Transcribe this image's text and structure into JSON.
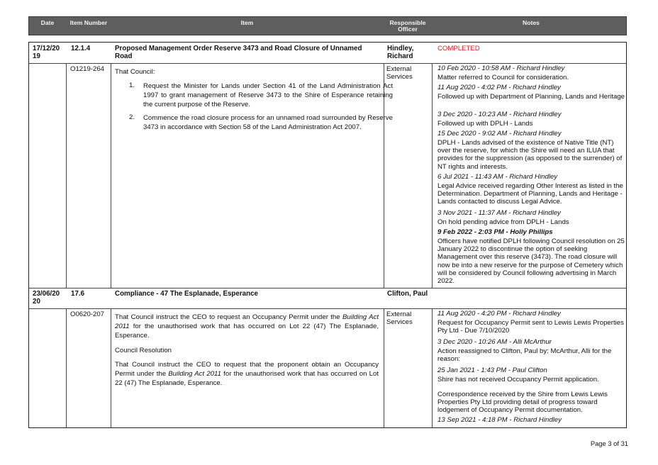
{
  "header": {
    "date": "Date",
    "item_number": "Item Number",
    "item": "Item",
    "responsible_officer": "Responsible Officer",
    "notes": "Notes"
  },
  "rows": [
    {
      "date": "17/12/20 19",
      "item_no": "12.1.4",
      "title": "Proposed Management Order Reserve 3473 and Road Closure of Unnamed Road",
      "officer": "Hindley, Richard",
      "status": "COMPLETED",
      "resolution_no": "O1219-264",
      "department": "External Services",
      "body_intro": "That Council:",
      "body_list": [
        {
          "n": "1.",
          "text": "Request the Minister for Lands under Section 41 of the Land Administration Act 1997 to grant management of Reserve 3473 to the Shire of Esperance retaining the current purpose of the Reserve."
        },
        {
          "n": "2.",
          "text": "Commence the road closure process for an unnamed road surrounded by Reserve 3473 in accordance with Section 58 of the Land Administration Act 2007."
        }
      ],
      "notes": [
        {
          "stamp": "10 Feb 2020 - 10:58 AM - Richard Hindley",
          "text": "Matter referred to Council for consideration."
        },
        {
          "stamp": "11 Aug 2020 - 4:02 PM - Richard Hindley",
          "text": "Followed up with Department of Planning, Lands and Heritage"
        },
        {
          "stamp": "3 Dec 2020 - 10:23 AM - Richard Hindley",
          "text": "Followed up with DPLH - Lands"
        },
        {
          "stamp": "15 Dec 2020 - 9:02 AM - Richard Hindley",
          "text": "DPLH - Lands advised of the existence of Native Title (NT) over the reserve, for which the Shire will need an ILUA that provides for the suppression (as opposed to the surrender) of NT rights and interests."
        },
        {
          "stamp": "6 Jul 2021 - 11:43 AM - Richard Hindley",
          "text": "Legal Advice received regarding Other Interest as listed in the Determination. Department of Planning, Lands and Heritage - Lands contacted to discuss Legal Advice."
        },
        {
          "stamp": "3 Nov 2021 - 11:37 AM - Richard Hindley",
          "text": "On hold pending advice from DPLH - Lands"
        },
        {
          "stamp": "9 Feb 2022 - 2:03 PM - Holly Phillips",
          "text": "Officers have notified DPLH following Council resolution on 25 January 2022 to discontinue the option of seeking Management over this reserve (3473). The road closure will now be into a new reserve for the purpose of Cemetery which will be considered by Council following advertising in March 2022."
        }
      ]
    },
    {
      "date": "23/06/20 20",
      "item_no": "17.6",
      "title": "Compliance - 47 The Esplanade, Esperance",
      "officer": "Clifton, Paul",
      "resolution_no": "O0620-207",
      "department": "External Services",
      "body_p1_a": "That Council instruct the CEO to request an Occupancy Permit under the ",
      "body_p1_act": "Building Act 2011",
      "body_p1_b": " for the unauthorised work that has occurred on Lot 22 (47) The Esplanade, Esperance.",
      "council_resolution": "Council Resolution",
      "body_p2_a": "That Council instruct the CEO to request that the proponent obtain an Occupancy Permit under the ",
      "body_p2_act": "Building Act 2011",
      "body_p2_b": " for the unauthorised work that has occurred on Lot 22 (47) The Esplanade, Esperance.",
      "notes": [
        {
          "stamp": "11 Aug 2020 - 4:20 PM - Richard Hindley",
          "text": "Request for Occupancy Permit sent to Lewis Lewis Properties Pty Ltd - Due 7/10/2020"
        },
        {
          "stamp": "3 Dec 2020 - 10:26 AM - Alli McArthur",
          "text": "Action reassigned to Clifton, Paul by: McArthur, Alli for the reason:"
        },
        {
          "stamp": "25 Jan 2021 - 1:43 PM - Paul Clifton",
          "text": "Shire has not received Occupancy Permit application."
        },
        {
          "stamp": "",
          "text": "Correspondence received by the Shire from Lewis Lewis Properties Pty Ltd providing detail of progress toward lodgement of Occupancy Permit documentation."
        },
        {
          "stamp": "13 Sep 2021 - 4:18 PM - Richard Hindley",
          "text": ""
        }
      ]
    }
  ],
  "footer": {
    "page": "Page 3 of 31"
  }
}
